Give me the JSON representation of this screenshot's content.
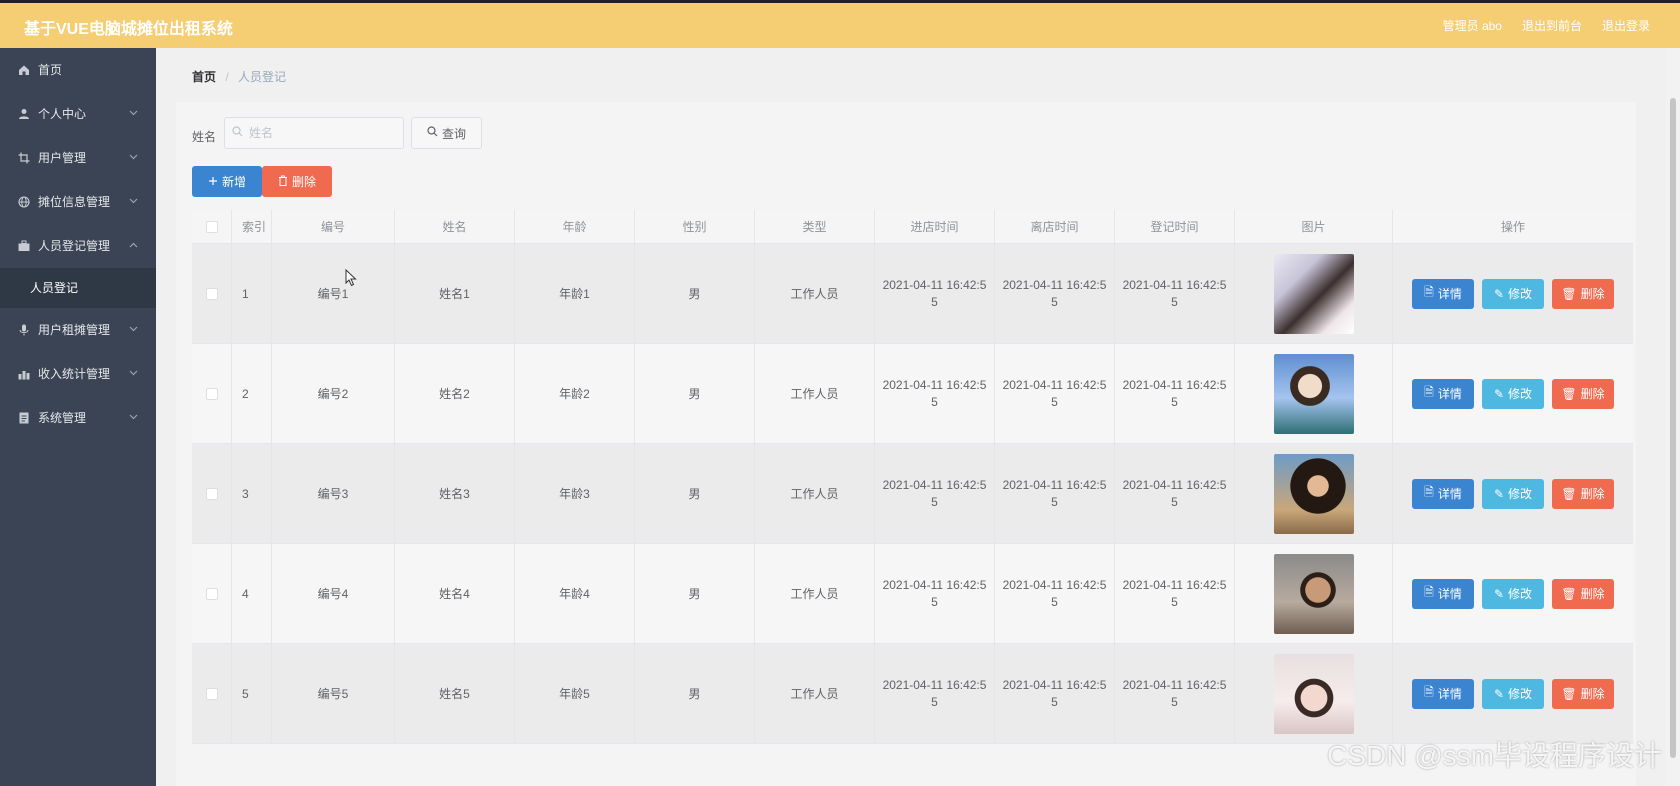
{
  "app": {
    "title": "基于VUE电脑城摊位出租系统"
  },
  "topbar": {
    "admin": "管理员 abo",
    "back_front": "退出到前台",
    "logout": "退出登录"
  },
  "sidebar": {
    "items": [
      {
        "label": "首页",
        "icon": "home-icon"
      },
      {
        "label": "个人中心",
        "icon": "user-icon"
      },
      {
        "label": "用户管理",
        "icon": "crop-icon"
      },
      {
        "label": "摊位信息管理",
        "icon": "globe-icon"
      },
      {
        "label": "人员登记管理",
        "icon": "briefcase-icon"
      },
      {
        "label": "人员登记",
        "icon": ""
      },
      {
        "label": "用户租摊管理",
        "icon": "mic-icon"
      },
      {
        "label": "收入统计管理",
        "icon": "chart-icon"
      },
      {
        "label": "系统管理",
        "icon": "doc-icon"
      }
    ]
  },
  "breadcrumb": {
    "home": "首页",
    "sep": "/",
    "current": "人员登记"
  },
  "search": {
    "label": "姓名",
    "placeholder": "姓名",
    "query": "查询"
  },
  "toolbar": {
    "add": "新增",
    "delete": "删除"
  },
  "table": {
    "headers": [
      "索引",
      "编号",
      "姓名",
      "年龄",
      "性别",
      "类型",
      "进店时间",
      "离店时间",
      "登记时间",
      "图片",
      "操作"
    ],
    "rows": [
      {
        "idx": "1",
        "code": "编号1",
        "name": "姓名1",
        "age": "年龄1",
        "sex": "男",
        "type": "工作人员",
        "t_in": "2021-04-11 16:42:55",
        "t_out": "2021-04-11 16:42:55",
        "t_reg": "2021-04-11 16:42:55"
      },
      {
        "idx": "2",
        "code": "编号2",
        "name": "姓名2",
        "age": "年龄2",
        "sex": "男",
        "type": "工作人员",
        "t_in": "2021-04-11 16:42:55",
        "t_out": "2021-04-11 16:42:55",
        "t_reg": "2021-04-11 16:42:55"
      },
      {
        "idx": "3",
        "code": "编号3",
        "name": "姓名3",
        "age": "年龄3",
        "sex": "男",
        "type": "工作人员",
        "t_in": "2021-04-11 16:42:55",
        "t_out": "2021-04-11 16:42:55",
        "t_reg": "2021-04-11 16:42:55"
      },
      {
        "idx": "4",
        "code": "编号4",
        "name": "姓名4",
        "age": "年龄4",
        "sex": "男",
        "type": "工作人员",
        "t_in": "2021-04-11 16:42:55",
        "t_out": "2021-04-11 16:42:55",
        "t_reg": "2021-04-11 16:42:55"
      },
      {
        "idx": "5",
        "code": "编号5",
        "name": "姓名5",
        "age": "年龄5",
        "sex": "男",
        "type": "工作人员",
        "t_in": "2021-04-11 16:42:55",
        "t_out": "2021-04-11 16:42:55",
        "t_reg": "2021-04-11 16:42:55"
      }
    ],
    "actions": {
      "detail": "详情",
      "edit": "修改",
      "delete": "删除"
    }
  },
  "watermark": "CSDN @ssm毕设程序设计",
  "colors": {
    "topbar": "#f5cd72",
    "sidebar": "#3a4454",
    "primary": "#3a84d0",
    "danger": "#ef6a4f",
    "info": "#4fb8e0"
  }
}
